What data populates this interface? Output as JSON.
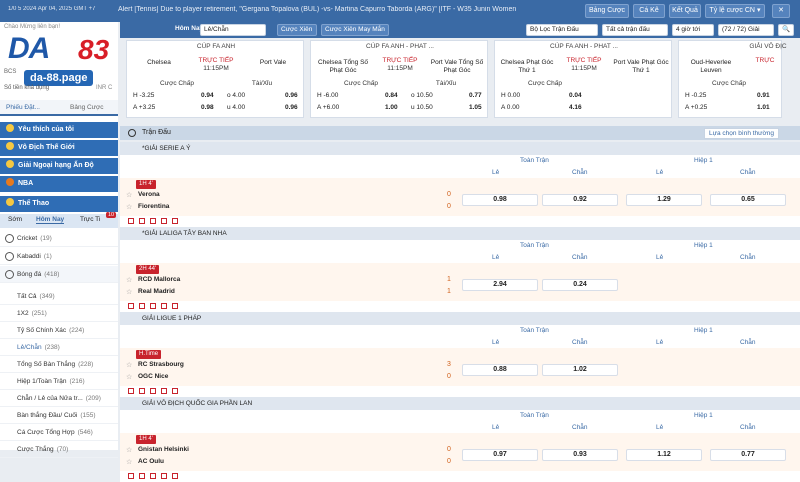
{
  "header": {
    "ticker_time": "1/0 5 2024 Apr 04, 2025 GMT +7",
    "ticker": "Alert [Tennis] Due to player retirement, \"Gergana Topalova (BUL) -vs- Martina Capurro Taborda (ARG)\" [ITF - W35 Junin Women",
    "buttons": [
      "Bảng Cược",
      "Cá Kê",
      "Kết Quả"
    ],
    "odds_type": "Tỷ lệ cược CN",
    "odds_type_caret": "▾",
    "close": "✕"
  },
  "controls": {
    "home": "Hôm Nay",
    "bet_type": "Lẻ/Chẵn",
    "combo": "Cược Xiên",
    "combo_lucky": "Cược Xiên May Mắn",
    "filter": "Bộ Lọc Trận Đấu",
    "all": "Tất cả trận đấu",
    "hours": "4 giờ tới",
    "count": "(72 / 72) Giải",
    "search_icon_glyph": "🔍"
  },
  "sidebar": {
    "logo_da": "DA",
    "logo_num": "83",
    "logo_url": "da-88.page",
    "welcome": "Chào Mừng liên bạn!",
    "acct_name": "BCS",
    "balance_label": "Số tiền khả dụng",
    "inr": "INR C",
    "tab_bet": "Phiếu Đặt...",
    "tab_board": "Bảng Cược",
    "sections": [
      "Yêu thích của tôi",
      "Vô Địch Thế Giới",
      "Giải Ngoại hạng Ấn Độ",
      "NBA",
      "Thể Thao"
    ],
    "time_tabs": [
      "Sớm",
      "Hôm Nay",
      "Trực Ti"
    ],
    "live_count": "10",
    "sports": [
      {
        "name": "Cricket",
        "count": "(19)"
      },
      {
        "name": "Kabaddi",
        "count": "(1)"
      },
      {
        "name": "Bóng đá",
        "count": "(418)"
      }
    ],
    "subs": [
      {
        "name": "Tất Cả",
        "count": "(349)"
      },
      {
        "name": "1X2",
        "count": "(251)"
      },
      {
        "name": "Tỷ Số Chính Xác",
        "count": "(224)"
      },
      {
        "name": "Lẻ/Chẵn",
        "count": "(238)"
      },
      {
        "name": "Tổng Số Bàn Thắng",
        "count": "(228)"
      },
      {
        "name": "Hiệp 1/Toàn Trận",
        "count": "(216)"
      },
      {
        "name": "Chẵn / Lẻ của Nửa tr...",
        "count": "(209)"
      },
      {
        "name": "Bàn thắng Đầu/ Cuối",
        "count": "(155)"
      },
      {
        "name": "Cá Cược Tổng Hợp",
        "count": "(546)"
      },
      {
        "name": "Cược Thắng",
        "count": "(70)"
      }
    ]
  },
  "cards": [
    {
      "league": "CÚP FA ANH",
      "t1": "Chelsea",
      "t2": "Port Vale",
      "live": "TRỰC TIẾP",
      "time": "11:15PM",
      "m1": "Cược Chấp",
      "m2": "Tài/Xỉu",
      "r1": [
        "H -3.25",
        "0.94",
        "o 4.00",
        "0.96"
      ],
      "r2": [
        "A +3.25",
        "0.98",
        "u 4.00",
        "0.96"
      ]
    },
    {
      "league": "CÚP FA ANH - PHAT ...",
      "t1": "Chelsea Tổng Số Phạt Góc",
      "t2": "Port Vale Tổng Số Phạt Góc",
      "live": "TRỰC TIẾP",
      "time": "11:15PM",
      "m1": "Cược Chấp",
      "m2": "Tài/Xỉu",
      "r1": [
        "H -6.00",
        "0.84",
        "o 10.50",
        "0.77"
      ],
      "r2": [
        "A +6.00",
        "1.00",
        "u 10.50",
        "1.05"
      ]
    },
    {
      "league": "CÚP FA ANH - PHAT ...",
      "t1": "Chelsea Phạt Góc Thứ 1",
      "t2": "Port Vale Phạt Góc Thứ 1",
      "live": "TRỰC TIẾP",
      "time": "11:15PM",
      "m1": "Cược Chấp",
      "m2": "",
      "r1": [
        "H 0.00",
        "0.04",
        "",
        ""
      ],
      "r2": [
        "A 0.00",
        "4.16",
        "",
        ""
      ]
    },
    {
      "league": "GIẢI VÔ ĐỊC",
      "t1": "Oud-Heverlee Leuven",
      "t2": "",
      "live": "TRỰC",
      "time": "",
      "m1": "Cược Chấp",
      "m2": "",
      "r1": [
        "H -0.25",
        "0.91",
        "",
        ""
      ],
      "r2": [
        "A +0.25",
        "1.01",
        "",
        ""
      ]
    }
  ],
  "list": {
    "title": "Trận Đấu",
    "sort": "Lựa chọn bình thường",
    "col_full": "Toàn Trận",
    "col_half": "Hiệp 1",
    "odd": "Lẻ",
    "even": "Chẵn",
    "leagues": [
      {
        "name": "*GIẢI SERIE A Ý",
        "status": "1H 4'",
        "home": "Verona",
        "away": "Fiorentina",
        "hs": "0",
        "as": "0",
        "o": [
          "0.98",
          "0.92",
          "1.29",
          "0.65"
        ]
      },
      {
        "name": "*GIẢI LALIGA TÂY BAN NHA",
        "status": "2H 44'",
        "home": "RCD Mallorca",
        "away": "Real Madrid",
        "hs": "1",
        "as": "1",
        "o": [
          "2.94",
          "0.24",
          "",
          ""
        ]
      },
      {
        "name": "GIẢI LIGUE 1 PHÁP",
        "status": "H.Time",
        "home": "RC Strasbourg",
        "away": "OGC Nice",
        "hs": "3",
        "as": "0",
        "o": [
          "0.88",
          "1.02",
          "",
          ""
        ]
      },
      {
        "name": "GIẢI VÔ ĐỊCH QUỐC GIA PHẦN LAN",
        "status": "1H 4'",
        "home": "Gnistan Helsinki",
        "away": "AC Oulu",
        "hs": "0",
        "as": "0",
        "o": [
          "0.97",
          "0.93",
          "1.12",
          "0.77"
        ]
      }
    ]
  },
  "colors": {
    "brand": "#3a6aa5",
    "accent": "#c8232c",
    "section": "#2f6db5"
  }
}
